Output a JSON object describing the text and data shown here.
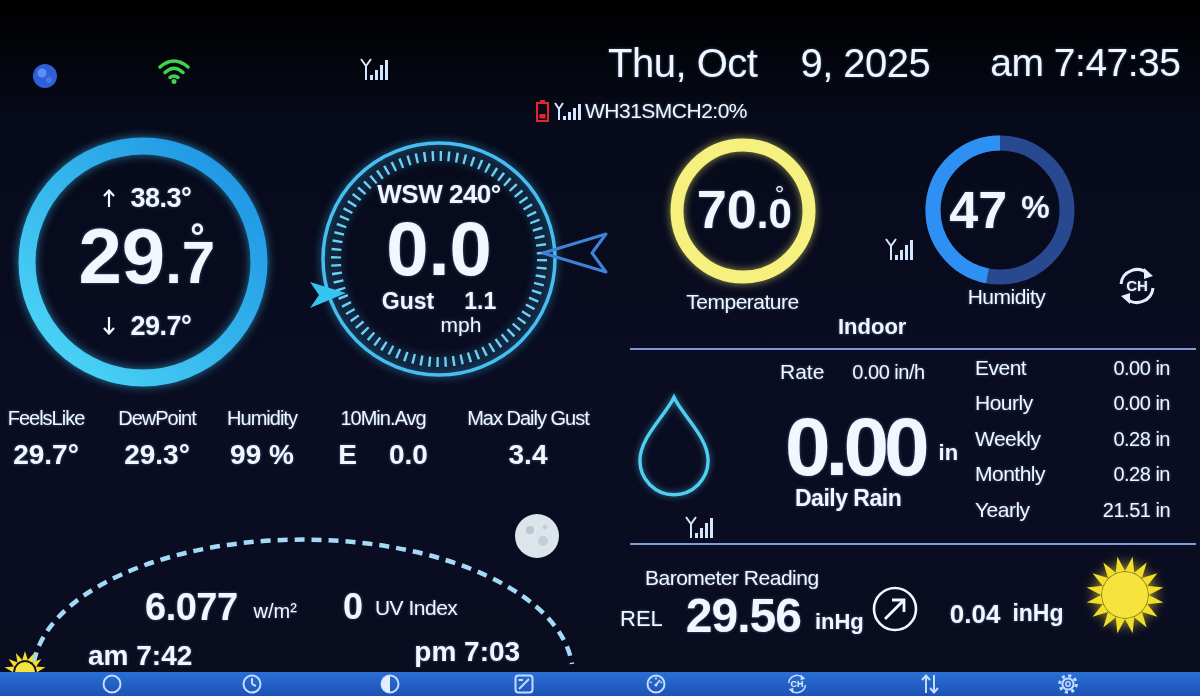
{
  "status_bar": {
    "date_weekday_month": "Thu, Oct",
    "date_day_year": "9, 2025",
    "time": "am 7:47:35",
    "sensor_status": "WH31SMCH2:0%"
  },
  "outdoor": {
    "high": "38.3°",
    "temperature": {
      "whole": "29",
      "fraction": ".7",
      "unit": "°"
    },
    "low": "29.7°",
    "stats": [
      {
        "label": "FeelsLike",
        "value": "29.7°"
      },
      {
        "label": "DewPoint",
        "value": "29.3°"
      },
      {
        "label": "Humidity",
        "value": "99 %"
      }
    ]
  },
  "wind": {
    "direction": "WSW 240°",
    "speed": "0.0",
    "gust_label": "Gust",
    "gust": "1.1",
    "unit": "mph",
    "stats": [
      {
        "label": "10Min.Avg",
        "direction": "E",
        "value": "0.0"
      },
      {
        "label": "Max Daily Gust",
        "value": "3.4"
      }
    ]
  },
  "solar": {
    "radiation": "6.077",
    "radiation_unit": "w/m²",
    "uv": "0",
    "uv_label": "UV Index",
    "sunrise": "am 7:42",
    "sunset": "pm 7:03"
  },
  "indoor": {
    "temperature": {
      "whole": "70",
      "fraction": ".0",
      "unit": "°",
      "label": "Temperature"
    },
    "humidity": {
      "value": "47",
      "unit": "%",
      "level": 0.47,
      "label": "Humidity"
    },
    "channel_button": "CH",
    "title": "Indoor"
  },
  "rain": {
    "rate_label": "Rate",
    "rate": "0.00 in/h",
    "daily": "0.00",
    "daily_unit": "in",
    "daily_label": "Daily Rain",
    "totals": [
      {
        "label": "Event",
        "value": "0.00 in"
      },
      {
        "label": "Hourly",
        "value": "0.00 in"
      },
      {
        "label": "Weekly",
        "value": "0.28 in"
      },
      {
        "label": "Monthly",
        "value": "0.28 in"
      },
      {
        "label": "Yearly",
        "value": "21.51 in"
      }
    ]
  },
  "barometer": {
    "title": "Barometer Reading",
    "mode": "REL",
    "value": "29.56",
    "unit": "inHg",
    "change": "0.04",
    "change_unit": "inHg"
  },
  "toolbar": {
    "channel_button": "CH"
  }
}
